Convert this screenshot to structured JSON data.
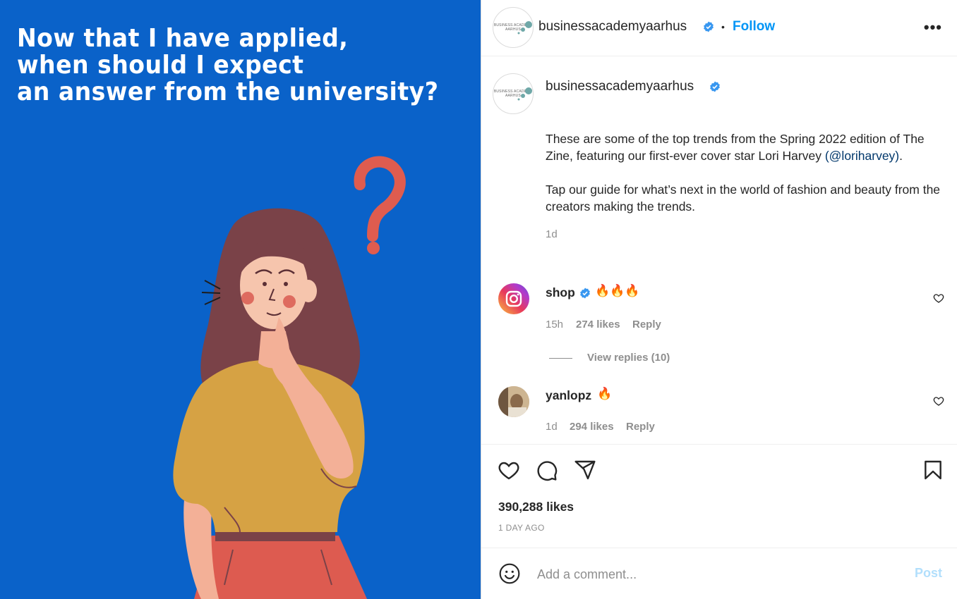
{
  "post_image": {
    "headline_lines": [
      "Now that I have applied,",
      "when should I expect",
      "an answer from the university?"
    ],
    "background_color": "#0a62c9"
  },
  "header": {
    "username": "businessacademyaarhus",
    "separator": "•",
    "follow_label": "Follow",
    "more_icon": "more-horizontal-icon",
    "avatar_text": "BUSINESS ACADEMY AARHUS"
  },
  "caption": {
    "username": "businessacademyaarhus",
    "paragraph1_text": "These are some of the top trends from the Spring 2022 edition of The Zine, featuring our first-ever cover star Lori Harvey ",
    "paragraph1_mention": "(@loriharvey)",
    "paragraph1_end": ".",
    "paragraph2": "Tap our guide for what’s next in the world of fashion and beauty from the creators making the trends.",
    "time": "1d"
  },
  "comments": [
    {
      "username": "shop",
      "text": "🔥🔥🔥",
      "time": "15h",
      "likes": "274 likes",
      "reply_label": "Reply",
      "verified": true,
      "view_replies": "View replies (10)"
    },
    {
      "username": "yanlopz",
      "text": "🔥",
      "time": "1d",
      "likes": "294 likes",
      "reply_label": "Reply",
      "verified": false
    }
  ],
  "actions": {
    "icons": [
      "heart-icon",
      "comment-icon",
      "share-icon",
      "bookmark-icon"
    ],
    "likes": "390,288 likes",
    "time_ago": "1 DAY AGO"
  },
  "comment_box": {
    "placeholder": "Add a comment...",
    "post_label": "Post",
    "emoji_icon": "emoji-icon"
  },
  "colors": {
    "accent": "#0095f6",
    "verified": "#3897f0",
    "post_disabled": "#b2dffc",
    "mention": "#00376b"
  }
}
